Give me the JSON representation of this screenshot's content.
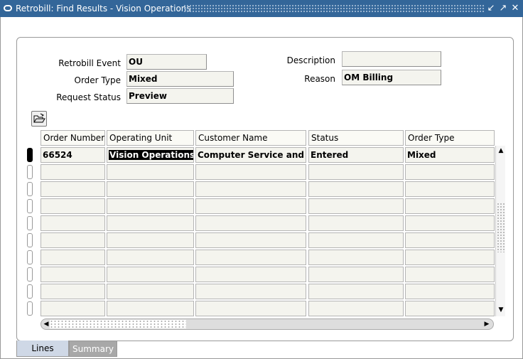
{
  "window": {
    "title": "Retrobill: Find Results - Vision Operations",
    "controls": [
      "↙",
      "↗",
      "✕"
    ]
  },
  "header": {
    "retrobill_event_label": "Retrobill Event",
    "retrobill_event_value": "OU",
    "description_label": "Description",
    "description_value": "",
    "order_type_label": "Order Type",
    "order_type_value": "Mixed",
    "reason_label": "Reason",
    "reason_value": "OM Billing",
    "request_status_label": "Request Status",
    "request_status_value": "Preview"
  },
  "grid": {
    "columns": [
      "Order Number",
      "Operating Unit",
      "Customer Name",
      "Status",
      "Order Type"
    ],
    "rows": [
      [
        "66524",
        "Vision Operations",
        "Computer Service and Rentals",
        "Entered",
        "Mixed"
      ],
      [
        "",
        "",
        "",
        "",
        ""
      ],
      [
        "",
        "",
        "",
        "",
        ""
      ],
      [
        "",
        "",
        "",
        "",
        ""
      ],
      [
        "",
        "",
        "",
        "",
        ""
      ],
      [
        "",
        "",
        "",
        "",
        ""
      ],
      [
        "",
        "",
        "",
        "",
        ""
      ],
      [
        "",
        "",
        "",
        "",
        ""
      ],
      [
        "",
        "",
        "",
        "",
        ""
      ],
      [
        "",
        "",
        "",
        "",
        ""
      ]
    ]
  },
  "icons": {
    "folder": "folder-open-icon",
    "scroll_up": "▲",
    "scroll_down": "▼",
    "scroll_left": "◀",
    "scroll_right": "▶"
  },
  "tabs": [
    {
      "label": "Lines",
      "active": true
    },
    {
      "label": "Summary",
      "active": false
    }
  ],
  "colors": {
    "title_bar": "#336699",
    "field_readonly": "#f4f4ee",
    "active_tab": "#cfd8e6",
    "inactive_tab": "#a8a8a8"
  }
}
